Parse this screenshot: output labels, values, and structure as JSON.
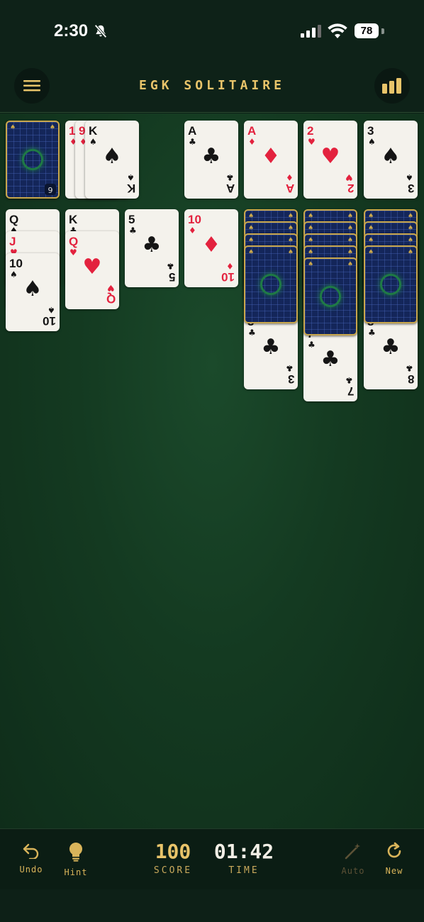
{
  "status_bar": {
    "time": "2:30",
    "battery": "78"
  },
  "header": {
    "title": "EGK SOLITAIRE",
    "menu_icon": "hamburger-icon",
    "stats_icon": "bar-chart-icon"
  },
  "stock": {
    "count": "6"
  },
  "waste": [
    {
      "rank": "1",
      "suit": "♦",
      "color": "red"
    },
    {
      "rank": "9",
      "suit": "♦",
      "color": "red"
    },
    {
      "rank": "K",
      "suit": "♠",
      "color": "black"
    }
  ],
  "foundations": [
    {
      "rank": "A",
      "suit": "♣",
      "color": "black"
    },
    {
      "rank": "A",
      "suit": "♦",
      "color": "red"
    },
    {
      "rank": "2",
      "suit": "♥",
      "color": "red"
    },
    {
      "rank": "3",
      "suit": "♠",
      "color": "black"
    }
  ],
  "tableau": [
    {
      "face_down": 0,
      "cards": [
        {
          "rank": "Q",
          "suit": "♠",
          "color": "black"
        },
        {
          "rank": "J",
          "suit": "♥",
          "color": "red"
        },
        {
          "rank": "10",
          "suit": "♠",
          "color": "black"
        }
      ]
    },
    {
      "face_down": 0,
      "cards": [
        {
          "rank": "K",
          "suit": "♣",
          "color": "black"
        },
        {
          "rank": "Q",
          "suit": "♥",
          "color": "red"
        }
      ]
    },
    {
      "face_down": 0,
      "cards": [
        {
          "rank": "5",
          "suit": "♣",
          "color": "black"
        }
      ]
    },
    {
      "face_down": 0,
      "cards": [
        {
          "rank": "10",
          "suit": "♦",
          "color": "red"
        }
      ]
    },
    {
      "face_down": 4,
      "cards": [
        {
          "rank": "3",
          "suit": "♣",
          "color": "black"
        }
      ]
    },
    {
      "face_down": 5,
      "cards": [
        {
          "rank": "7",
          "suit": "♣",
          "color": "black"
        }
      ]
    },
    {
      "face_down": 4,
      "cards": [
        {
          "rank": "8",
          "suit": "♣",
          "color": "black"
        }
      ]
    }
  ],
  "toolbar": {
    "undo_label": "Undo",
    "hint_label": "Hint",
    "score_value": "100",
    "score_label": "SCORE",
    "time_value": "01:42",
    "time_label": "TIME",
    "auto_label": "Auto",
    "new_label": "New"
  },
  "colors": {
    "gold": "#e8c46a",
    "felt": "#143a21",
    "card_back": "#14265a",
    "red_suit": "#e3223e"
  }
}
